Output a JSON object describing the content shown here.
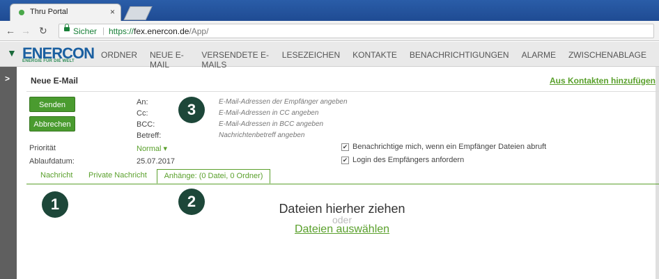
{
  "browser": {
    "tab_title": "Thru Portal",
    "tab_close": "×",
    "secure_label": "Sicher",
    "url_protocol": "https://",
    "url_host": "fex.enercon.de",
    "url_path": "/App/"
  },
  "app": {
    "logo": "ENERCON",
    "logo_sub": "ENERGIE FÜR DIE WELT",
    "nav": [
      "ORDNER",
      "NEUE E-MAIL",
      "VERSENDETE E-MAILS",
      "LESEZEICHEN",
      "KONTAKTE",
      "BENACHRICHTIGUNGEN",
      "ALARME",
      "ZWISCHENABLAGE"
    ]
  },
  "form": {
    "title": "Neue E-Mail",
    "add_contacts": "Aus Kontakten hinzufügen",
    "send_label": "Senden",
    "cancel_label": "Abbrechen",
    "to_label": "An:",
    "cc_label": "Cc:",
    "bcc_label": "BCC:",
    "subject_label": "Betreff:",
    "to_hint": "E-Mail-Adressen der Empfänger angeben",
    "cc_hint": "E-Mail-Adressen in CC angeben",
    "bcc_hint": "E-Mail-Adressen in BCC angeben",
    "subject_hint": "Nachrichtenbetreff angeben",
    "priority_label": "Priorität",
    "priority_value": "Normal",
    "expiry_label": "Ablaufdatum:",
    "expiry_value": "25.07.2017",
    "notify_label": "Benachrichtige mich, wenn ein Empfänger Dateien abruft",
    "login_label": "Login des Empfängers anfordern"
  },
  "tabs": {
    "message": "Nachricht",
    "private": "Private Nachricht",
    "attachments": "Anhänge: (0 Datei, 0 Ordner)"
  },
  "dropzone": {
    "title": "Dateien hierher ziehen",
    "or": "oder",
    "link": "Dateien auswählen"
  },
  "badges": {
    "one": "1",
    "two": "2",
    "three": "3"
  },
  "colors": {
    "accent": "#5aa02c",
    "badge": "#1d4739",
    "brand_blue": "#1a5fa0"
  }
}
